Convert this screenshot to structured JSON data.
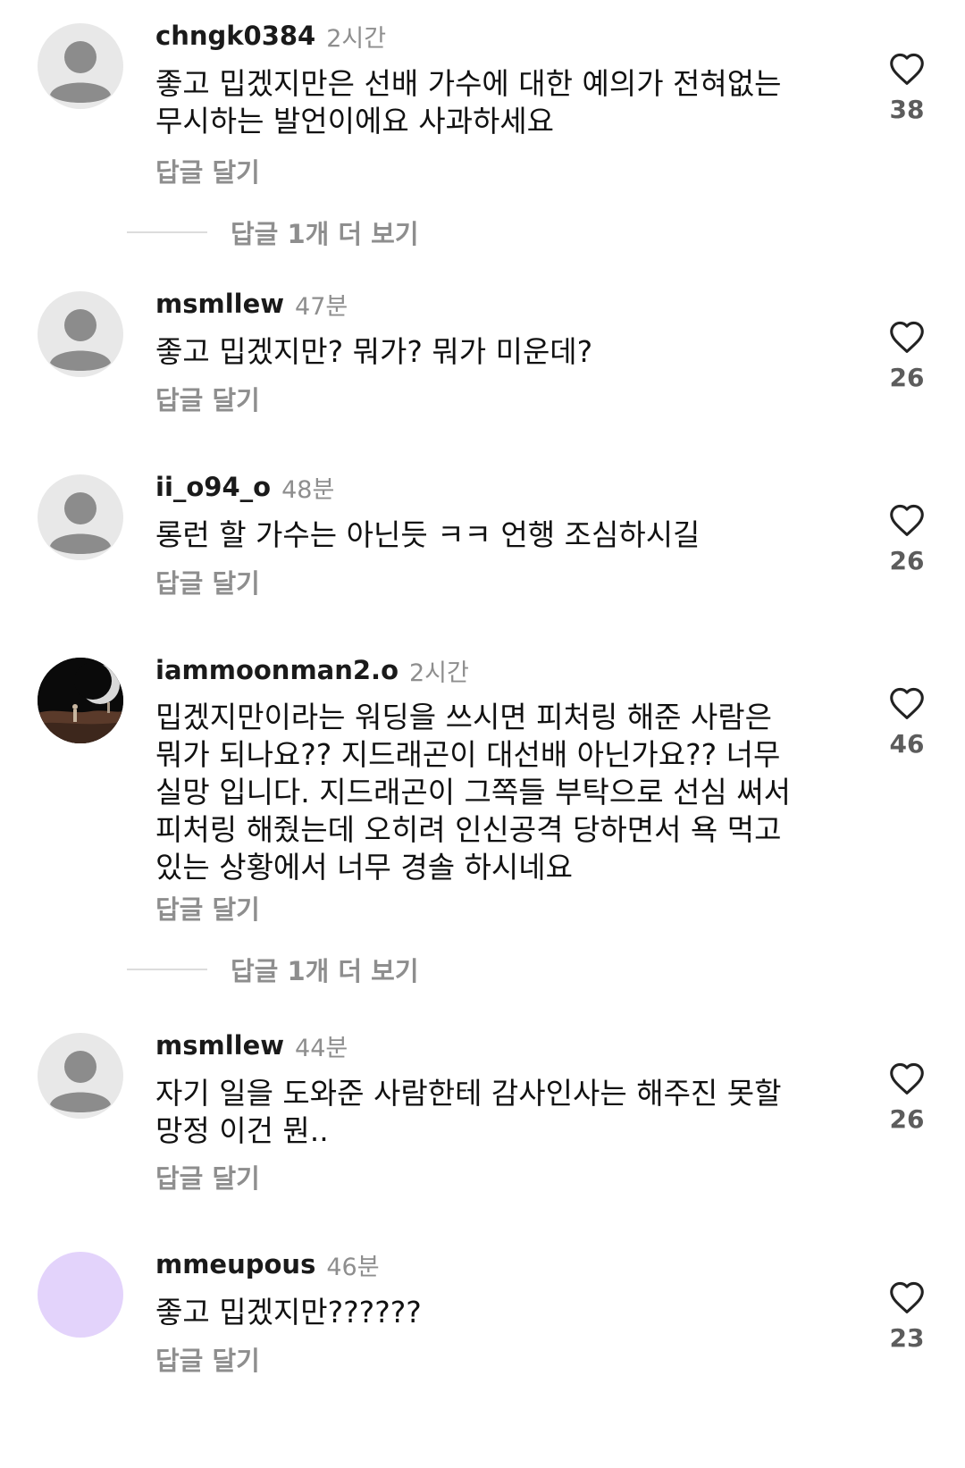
{
  "comments": [
    {
      "username": "chngk0384",
      "time": "2시간",
      "text": "좋고 밉겠지만은 선배 가수에 대한 예의가 전혀없는\n무시하는 발언이에요 사과하세요",
      "reply_label": "답글 달기",
      "likes": "38",
      "avatar": "default"
    },
    {
      "username": "msmllew",
      "time": "47분",
      "text": "좋고 밉겠지만? 뭐가? 뭐가 미운데?",
      "reply_label": "답글 달기",
      "likes": "26",
      "avatar": "default"
    },
    {
      "username": "ii_o94_o",
      "time": "48분",
      "text": "롱런 할 가수는 아닌듯 ㅋㅋ 언행 조심하시길",
      "reply_label": "답글 달기",
      "likes": "26",
      "avatar": "default"
    },
    {
      "username": "iammoonman2.o",
      "time": "2시간",
      "text": "밉겠지만이라는 워딩을 쓰시면 피처링 해준 사람은\n뭐가 되나요?? 지드래곤이 대선배 아닌가요?? 너무\n실망 입니다. 지드래곤이 그쪽들 부탁으로 선심 써서\n피처링 해줬는데 오히려 인신공격 당하면서 욕 먹고\n있는 상황에서 너무 경솔 하시네요",
      "reply_label": "답글 달기",
      "likes": "46",
      "avatar": "photo"
    },
    {
      "username": "msmllew",
      "time": "44분",
      "text": "자기 일을 도와준 사람한테 감사인사는 해주진 못할\n망정 이건 뭔..",
      "reply_label": "답글 달기",
      "likes": "26",
      "avatar": "default"
    },
    {
      "username": "mmeupous",
      "time": "46분",
      "text": "좋고 밉겠지만??????",
      "reply_label": "답글 달기",
      "likes": "23",
      "avatar": "lavender"
    }
  ],
  "view_more_replies": [
    {
      "label": "답글 1개 더 보기"
    },
    {
      "label": "답글 1개 더 보기"
    }
  ],
  "colors": {
    "default_avatar_bg": "#e8e8e8",
    "default_avatar_fg": "#8c8c8c",
    "lavender_avatar_bg": "#e3d3fb",
    "muted_text": "#8e8e8e"
  }
}
